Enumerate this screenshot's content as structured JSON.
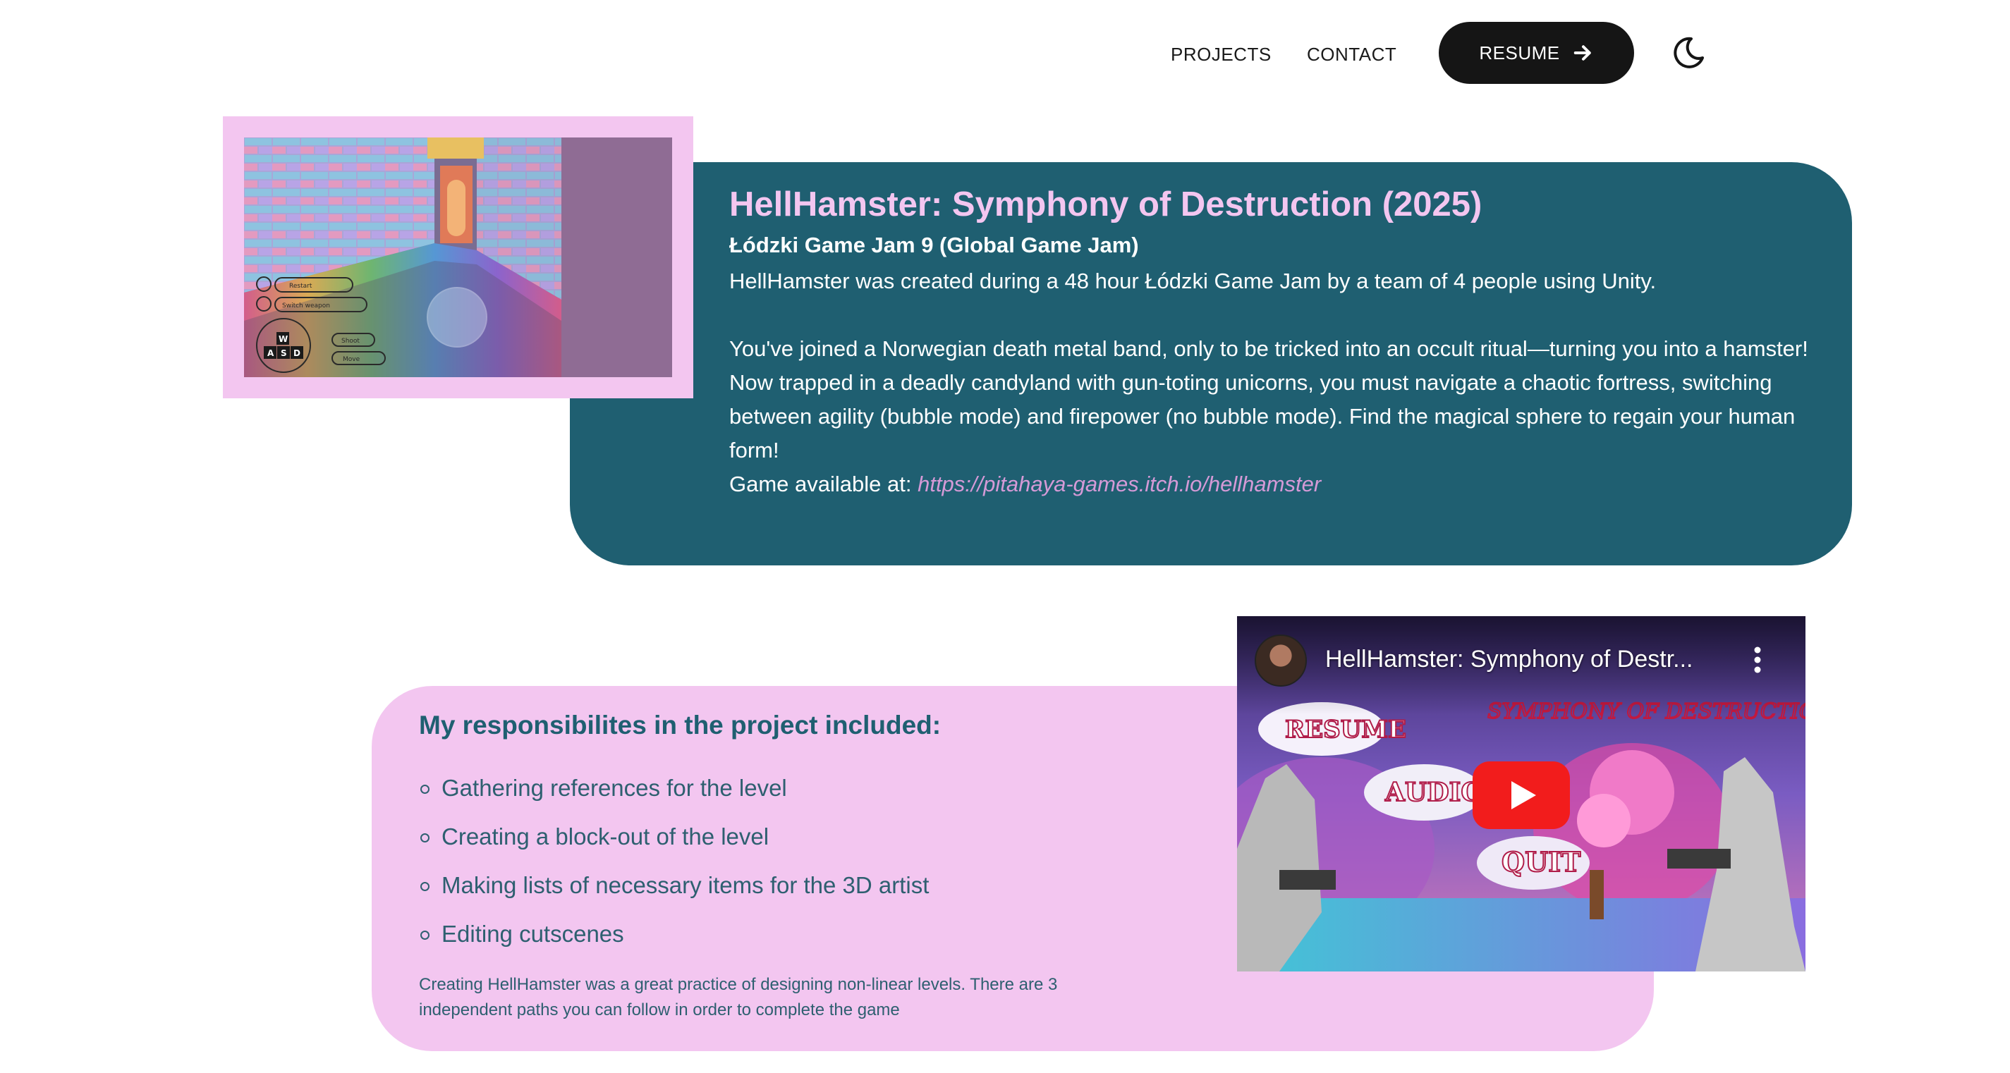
{
  "nav": {
    "projects": "PROJECTS",
    "contact": "CONTACT",
    "resume": "RESUME",
    "theme_icon": "moon-icon"
  },
  "colors": {
    "card_teal": "#1f5f71",
    "accent_pink": "#f3c6f0",
    "link_pink": "#d59ad7",
    "button_dark": "#151515"
  },
  "project": {
    "title": "HellHamster: Symphony of Destruction (2025)",
    "subtitle": "Łódzki Game Jam 9 (Global Game Jam)",
    "intro": "HellHamster was created during a 48 hour Łódzki Game Jam by a team of 4 people using Unity.",
    "story_1": "You've joined a Norwegian death metal band, only to be tricked into an occult ritual—turning you into a hamster!",
    "story_2": "Now trapped in a deadly candyland with gun-toting unicorns, you must navigate a chaotic fortress, switching between agility (bubble mode) and firepower (no bubble mode). Find the magical sphere to regain your human form!",
    "available_label": "Game available at: ",
    "link": "https://pitahaya-games.itch.io/hellhamster"
  },
  "screenshot": {
    "hud_keys": [
      "W",
      "A",
      "S",
      "D"
    ],
    "hud_labels": [
      "Restart",
      "Switch weapon",
      "Shoot",
      "Move"
    ]
  },
  "responsibilities": {
    "heading": "My responsibilites in the project included:",
    "items": [
      "Gathering references for the level",
      "Creating a block-out of the level",
      "Making lists of necessary items for the 3D artist",
      "Editing cutscenes"
    ],
    "note": "Creating HellHamster was a great practice of designing non-linear levels. There are 3 independent paths you can follow in order to complete the game"
  },
  "video": {
    "title": "HellHamster: Symphony of Destr...",
    "menu_resume": "RESUME",
    "menu_audio": "AUDIO",
    "menu_quit": "QUIT",
    "logo_text": "SYMPHONY OF DESTRUCTION"
  }
}
